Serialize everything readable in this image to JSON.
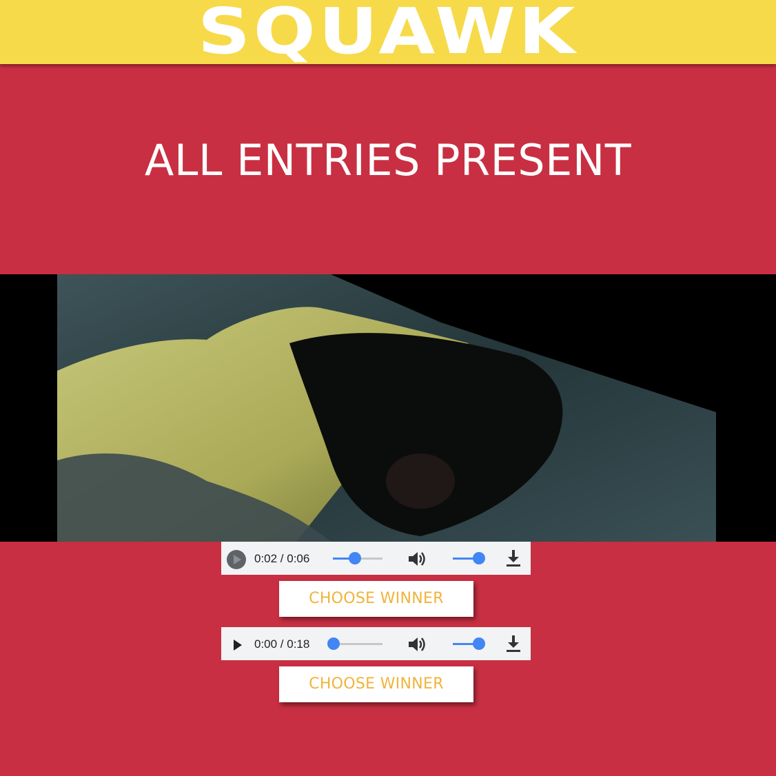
{
  "app": {
    "logo_text": "SQUAWK"
  },
  "page": {
    "title": "ALL ENTRIES PRESENT"
  },
  "colors": {
    "header_bg": "#f7da4a",
    "page_bg": "#c82f42",
    "button_text": "#f0b33b",
    "slider_accent": "#4285f4"
  },
  "video": {
    "icon": "video-frame"
  },
  "entries": [
    {
      "time": "0:02 / 0:06",
      "progress": 0.33,
      "volume": 0.9,
      "choose_label": "CHOOSE WINNER"
    },
    {
      "time": "0:00 / 0:18",
      "progress": 0.0,
      "volume": 0.9,
      "choose_label": "CHOOSE WINNER"
    }
  ],
  "icons": {
    "play": "play-icon",
    "volume": "volume-icon",
    "download": "download-icon"
  }
}
